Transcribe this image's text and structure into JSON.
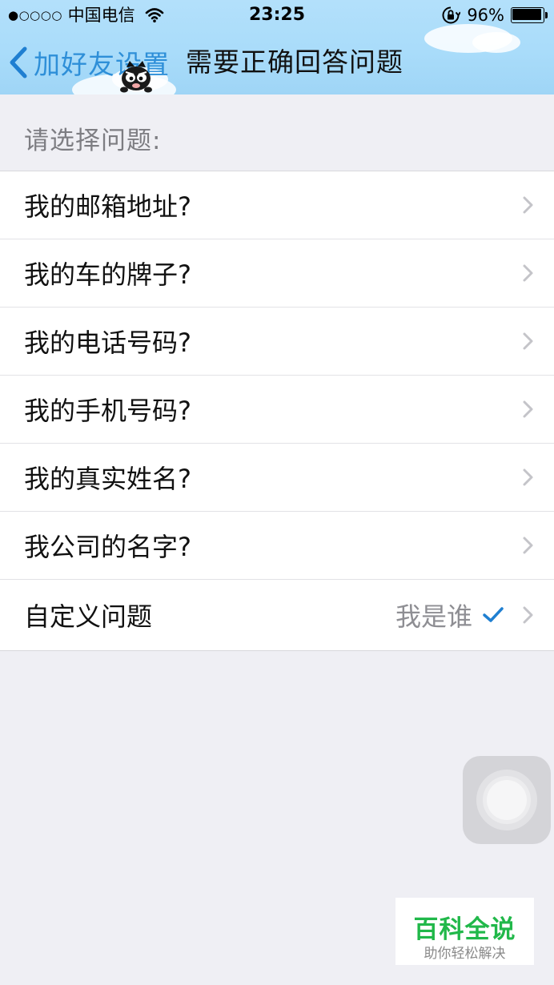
{
  "status_bar": {
    "signal": "●○○○○",
    "carrier": "中国电信",
    "time": "23:25",
    "battery_percent_label": "96%",
    "battery_level": 0.96
  },
  "nav": {
    "back_label": "加好友设置",
    "title": "需要正确回答问题"
  },
  "section": {
    "header": "请选择问题:"
  },
  "questions": [
    {
      "label": "我的邮箱地址?"
    },
    {
      "label": "我的车的牌子?"
    },
    {
      "label": "我的电话号码?"
    },
    {
      "label": "我的手机号码?"
    },
    {
      "label": "我的真实姓名?"
    },
    {
      "label": "我公司的名字?"
    },
    {
      "label": "自定义问题",
      "value": "我是谁",
      "selected": true
    }
  ],
  "watermark": {
    "title": "百科全说",
    "subtitle": "助你轻松解决"
  },
  "colors": {
    "accent": "#1f7fd1",
    "nav_background": "#aedcf9",
    "page_background": "#efeff4",
    "watermark_green": "#21b84a"
  },
  "icons": {
    "back": "chevron-left-icon",
    "row_disclosure": "chevron-right-icon",
    "selected": "checkmark-icon",
    "wifi": "wifi-icon",
    "rotation_lock": "rotation-lock-icon",
    "battery": "battery-icon",
    "mascot": "mascot-icon"
  }
}
